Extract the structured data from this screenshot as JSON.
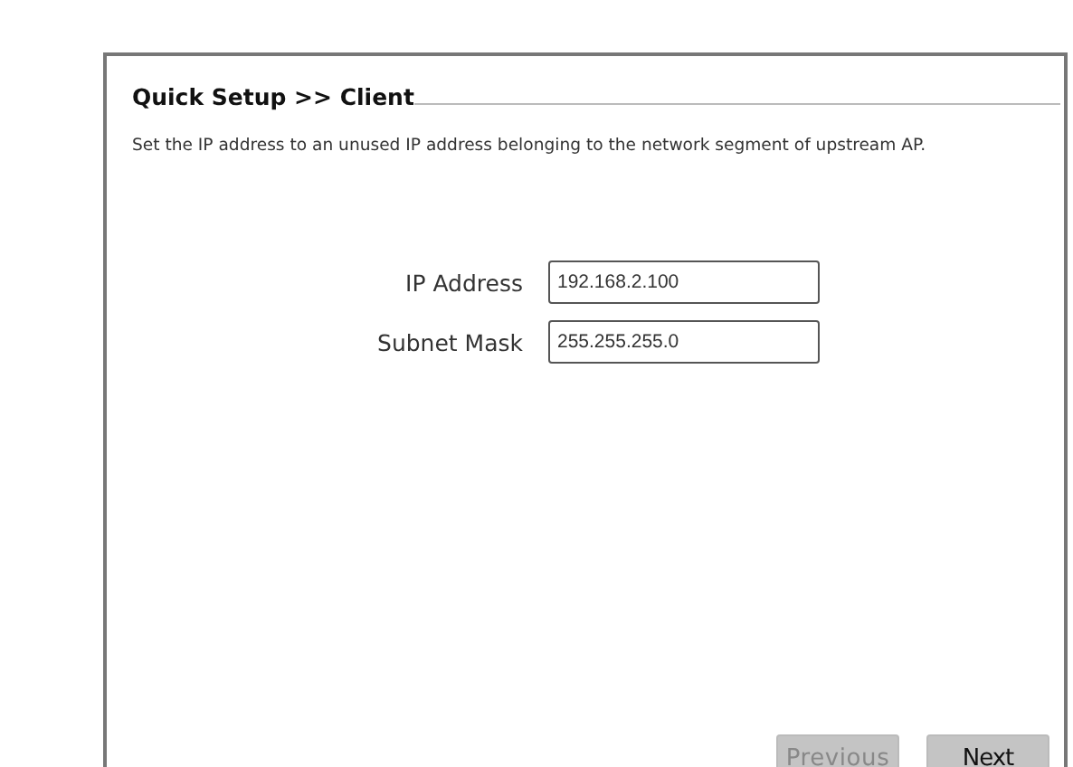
{
  "panel": {
    "title": "Quick Setup >> Client",
    "description": "Set the IP address to an unused IP address belonging to the network segment of upstream AP.",
    "fields": [
      {
        "label": "IP Address",
        "value": "192.168.2.100"
      },
      {
        "label": "Subnet Mask",
        "value": "255.255.255.0"
      }
    ],
    "buttons": [
      {
        "label": "Previous",
        "disabled": true
      },
      {
        "label": "Next",
        "disabled": false
      }
    ]
  }
}
